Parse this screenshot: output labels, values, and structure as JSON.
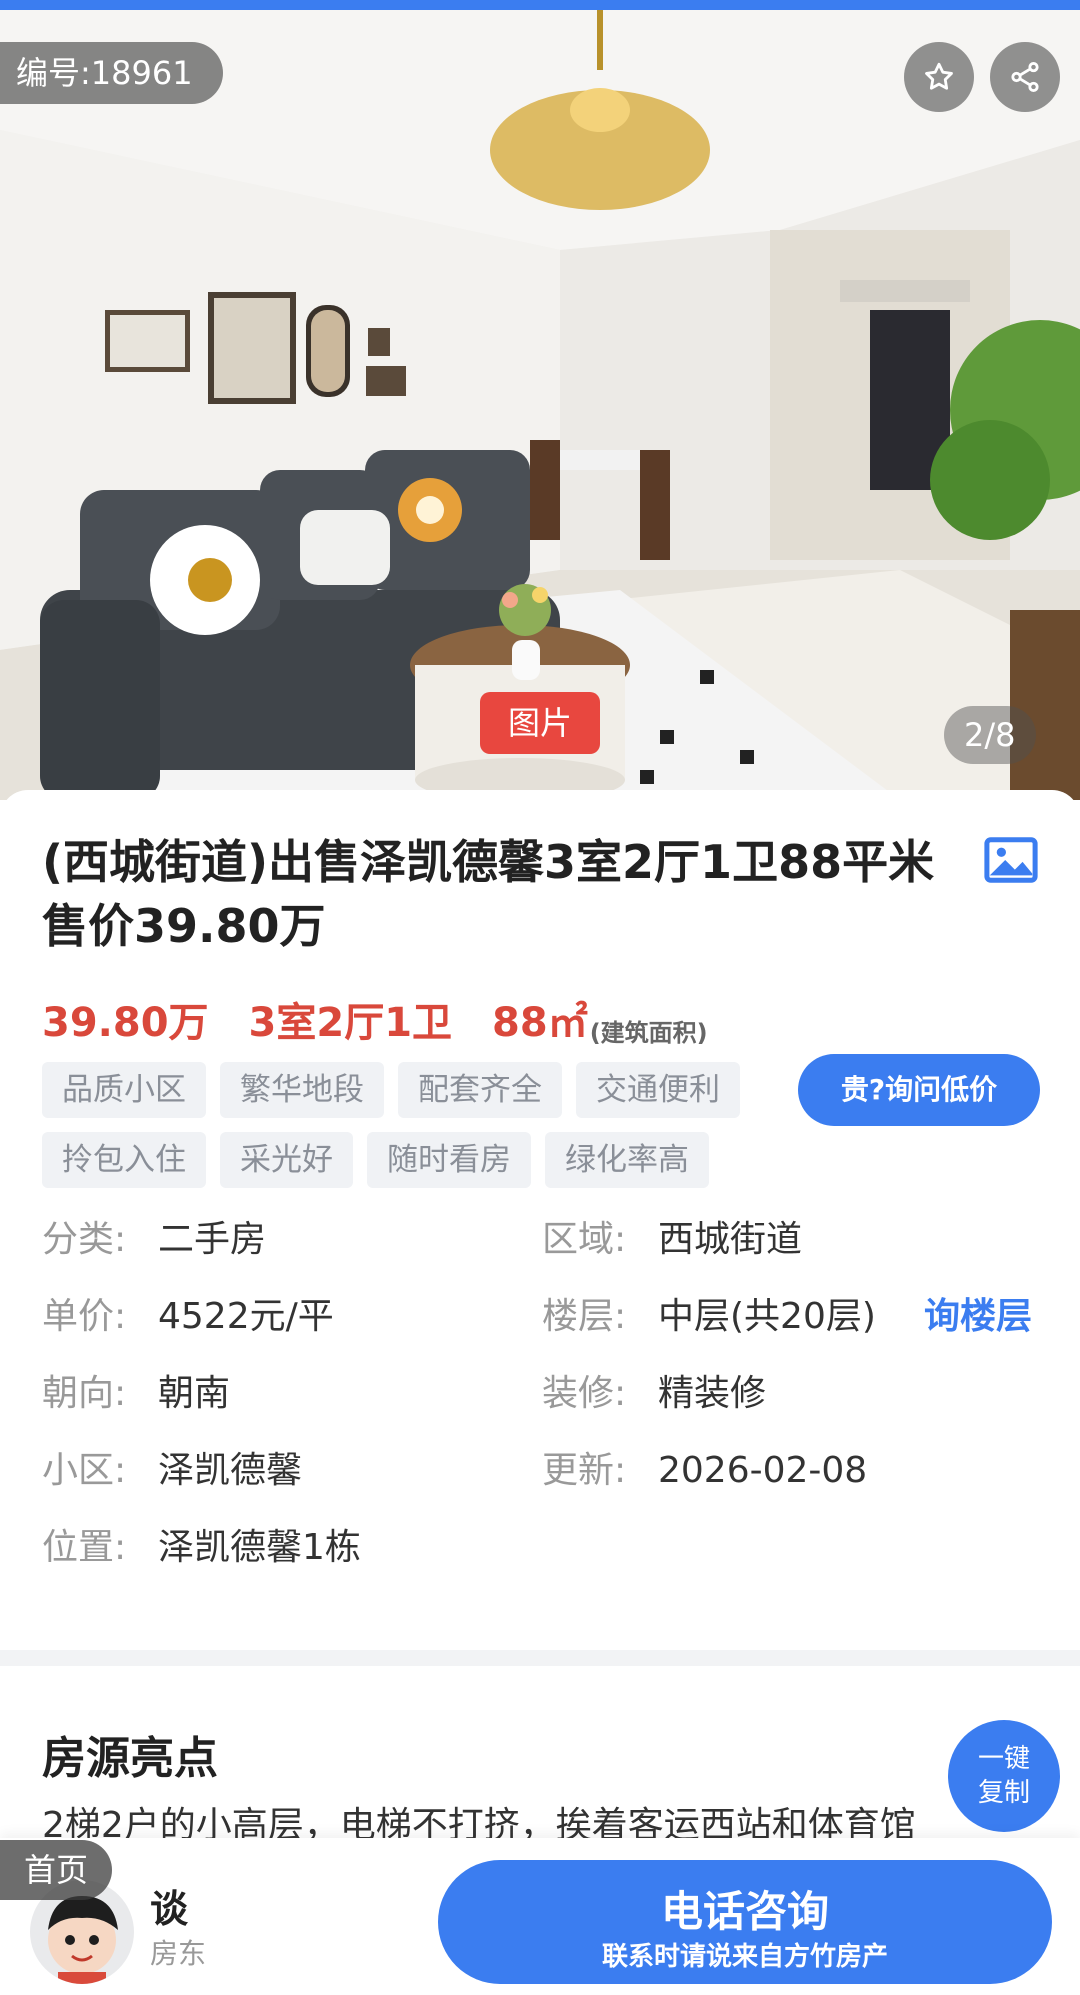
{
  "hero": {
    "listing_id": "编号:18961",
    "photo_tag": "图片",
    "photo_counter": "2/8",
    "favorite_icon": "star-icon",
    "share_icon": "share-icon"
  },
  "listing": {
    "title": "(西城街道)出售泽凯德馨3室2厅1卫88平米 售价39.80万",
    "price": "39.80万",
    "layout": "3室2厅1卫",
    "area": "88㎡",
    "area_note": "(建筑面积)",
    "tags": [
      "品质小区",
      "繁华地段",
      "配套齐全",
      "交通便利",
      "拎包入住",
      "采光好",
      "随时看房",
      "绿化率高"
    ],
    "ask_low_price": "贵?询问低价",
    "accent_color": "#3b7df0",
    "price_color": "#d9483b"
  },
  "details": {
    "category_label": "分类:",
    "category": "二手房",
    "district_label": "区域:",
    "district": "西城街道",
    "unit_price_label": "单价:",
    "unit_price": "4522元/平",
    "floor_label": "楼层:",
    "floor": "中层(共20层)",
    "ask_floor": "询楼层",
    "orientation_label": "朝向:",
    "orientation": "朝南",
    "decoration_label": "装修:",
    "decoration": "精装修",
    "community_label": "小区:",
    "community": "泽凯德馨",
    "updated_label": "更新:",
    "updated": "2026-02-08",
    "location_label": "位置:",
    "location": "泽凯德馨1栋"
  },
  "highlights": {
    "title": "房源亮点",
    "text": "2梯2户的小高层，电梯不打挤，挨着客运西站和体育馆",
    "copy_line1": "一键",
    "copy_line2": "复制"
  },
  "bottom": {
    "home": "首页",
    "agent_name": "谈",
    "agent_role": "房东",
    "call_main": "电话咨询",
    "call_sub": "联系时请说来自方竹房产"
  }
}
